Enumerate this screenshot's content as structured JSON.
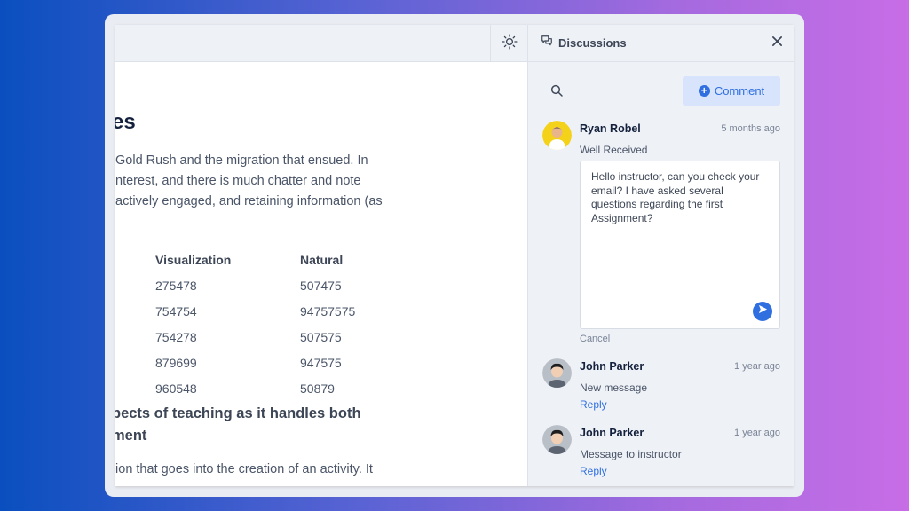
{
  "content": {
    "heading": "es",
    "paragraph_lines": [
      "Gold Rush and the migration that ensued. In",
      "nterest, and there is much chatter and note",
      "actively engaged, and retaining information (as"
    ],
    "table": {
      "columns": [
        "Visualization",
        "Natural"
      ],
      "rows": [
        [
          "275478",
          "507475"
        ],
        [
          "754754",
          "94757575"
        ],
        [
          "754278",
          "507575"
        ],
        [
          "879699",
          "947575"
        ],
        [
          "960548",
          "50879"
        ]
      ]
    },
    "subheading_lines": [
      "pects of teaching as it handles both",
      "ment"
    ],
    "paragraph2": "tion that goes into the creation of an activity. It"
  },
  "topbar": {
    "theme_icon": "sun-icon"
  },
  "panel": {
    "title": "Discussions",
    "title_icon": "chat-bubbles-icon",
    "close_icon": "close-icon",
    "search_icon": "search-icon",
    "comment_label": "Comment",
    "threads": [
      {
        "author": "Ryan Robel",
        "time": "5 months ago",
        "message": "Well Received",
        "reply_text": "Hello instructor, can you check your email? I have asked several questions regarding the first Assignment?",
        "cancel_label": "Cancel"
      },
      {
        "author": "John Parker",
        "time": "1 year ago",
        "message": "New message",
        "reply_label": "Reply"
      },
      {
        "author": "John Parker",
        "time": "1 year ago",
        "message": "Message to instructor",
        "reply_label": "Reply"
      }
    ]
  },
  "colors": {
    "accent": "#2f6fe0",
    "panel_bg": "#eef1f6",
    "heading": "#14213d"
  }
}
